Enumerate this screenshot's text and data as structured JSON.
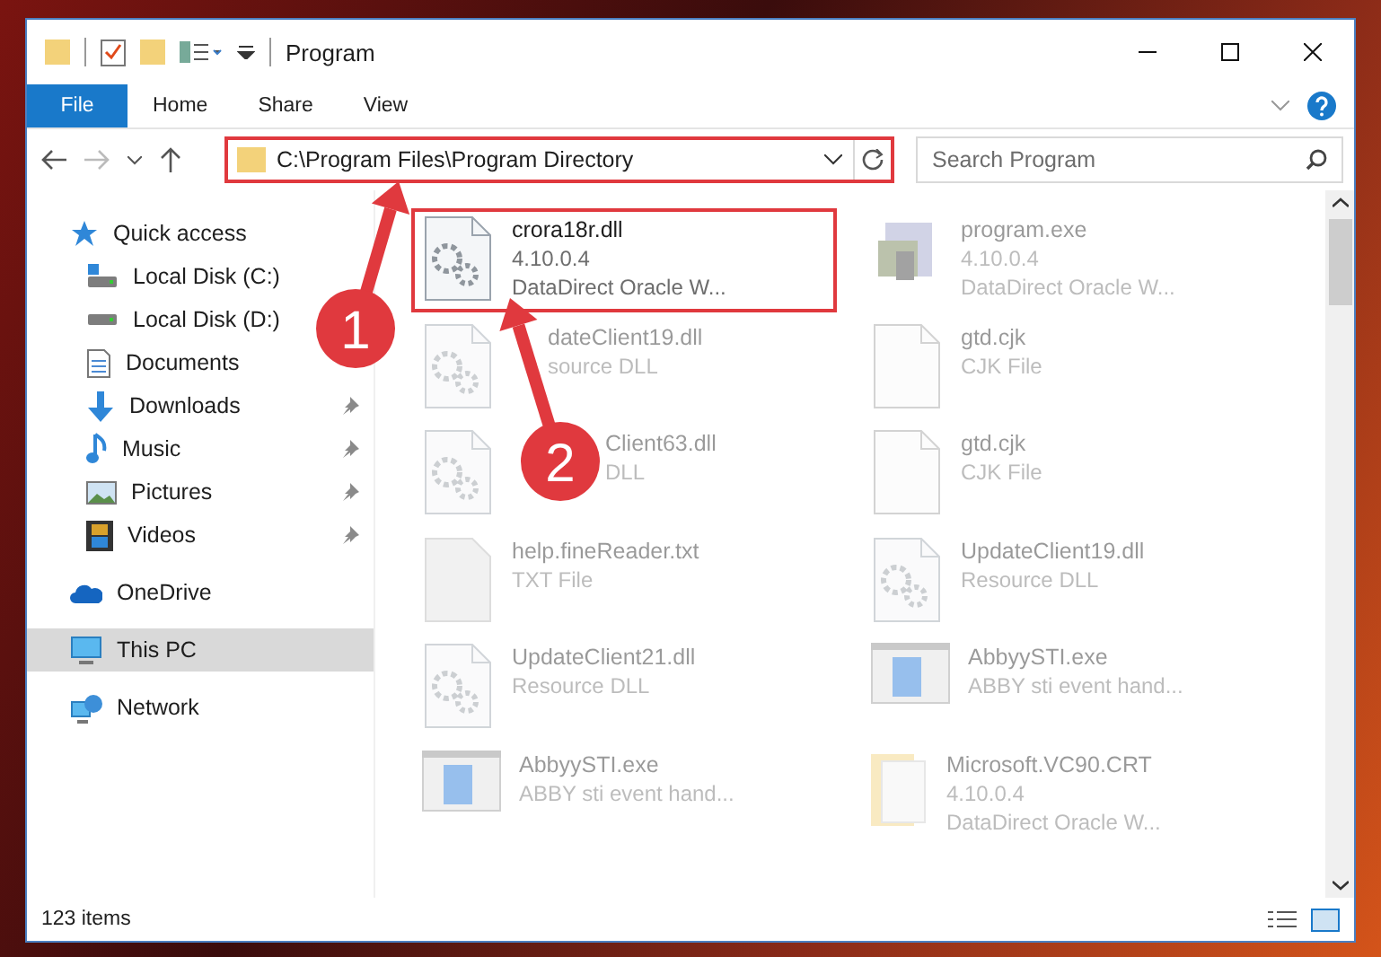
{
  "window": {
    "title": "Program"
  },
  "ribbon": {
    "tabs": [
      {
        "label": "File",
        "selected": true
      },
      {
        "label": "Home",
        "selected": false
      },
      {
        "label": "Share",
        "selected": false
      },
      {
        "label": "View",
        "selected": false
      }
    ]
  },
  "address_bar": {
    "path": "C:\\Program Files\\Program Directory",
    "highlighted": true
  },
  "search": {
    "placeholder": "Search Program"
  },
  "sidebar": {
    "items": [
      {
        "label": "Quick access",
        "kind": "star",
        "selected": false,
        "children": [
          {
            "label": "Local Disk (C:)",
            "kind": "disk-c",
            "pinned": false,
            "selected": false
          },
          {
            "label": "Local Disk (D:)",
            "kind": "disk",
            "pinned": false,
            "selected": false
          },
          {
            "label": "Documents",
            "kind": "doc",
            "pinned": false,
            "selected": false
          },
          {
            "label": "Downloads",
            "kind": "download",
            "pinned": true,
            "selected": false
          },
          {
            "label": "Music",
            "kind": "music",
            "pinned": true,
            "selected": false
          },
          {
            "label": "Pictures",
            "kind": "picture",
            "pinned": true,
            "selected": false
          },
          {
            "label": "Videos",
            "kind": "video",
            "pinned": true,
            "selected": false
          }
        ]
      },
      {
        "label": "OneDrive",
        "kind": "cloud",
        "selected": false
      },
      {
        "label": "This PC",
        "kind": "pc",
        "selected": true
      },
      {
        "label": "Network",
        "kind": "network",
        "selected": false
      }
    ]
  },
  "files": [
    {
      "name": "crora18r.dll",
      "kind": "gear",
      "details": [
        "4.10.0.4",
        "DataDirect Oracle W..."
      ],
      "highlighted": true,
      "blurred": false
    },
    {
      "name": "program.exe",
      "kind": "app",
      "details": [
        "4.10.0.4",
        "DataDirect Oracle W..."
      ],
      "highlighted": false,
      "blurred": true
    },
    {
      "name": "dateClient19.dll",
      "kind": "gear",
      "details": [
        "source DLL"
      ],
      "highlighted": false,
      "blurred": true
    },
    {
      "name": "gtd.cjk",
      "kind": "blank",
      "details": [
        "CJK File"
      ],
      "highlighted": false,
      "blurred": true
    },
    {
      "name": "Client63.dll",
      "kind": "gear",
      "details": [
        "DLL"
      ],
      "highlighted": false,
      "blurred": true
    },
    {
      "name": "gtd.cjk",
      "kind": "blank",
      "details": [
        "CJK File"
      ],
      "highlighted": false,
      "blurred": true
    },
    {
      "name": "help.fineReader.txt",
      "kind": "text",
      "details": [
        "TXT File"
      ],
      "highlighted": false,
      "blurred": true
    },
    {
      "name": "UpdateClient19.dll",
      "kind": "gear",
      "details": [
        "Resource DLL"
      ],
      "highlighted": false,
      "blurred": true
    },
    {
      "name": "UpdateClient21.dll",
      "kind": "gear",
      "details": [
        "Resource DLL"
      ],
      "highlighted": false,
      "blurred": true
    },
    {
      "name": "AbbyySTI.exe",
      "kind": "window",
      "details": [
        "ABBY sti event hand..."
      ],
      "highlighted": false,
      "blurred": true
    },
    {
      "name": "AbbyySTI.exe",
      "kind": "window",
      "details": [
        "ABBY sti event hand..."
      ],
      "highlighted": false,
      "blurred": true
    },
    {
      "name": "Microsoft.VC90.CRT",
      "kind": "folder",
      "details": [
        "4.10.0.4",
        "DataDirect Oracle W..."
      ],
      "highlighted": false,
      "blurred": true
    }
  ],
  "status_bar": {
    "item_count": "123 items"
  },
  "annotations": [
    {
      "number": "1"
    },
    {
      "number": "2"
    }
  ]
}
